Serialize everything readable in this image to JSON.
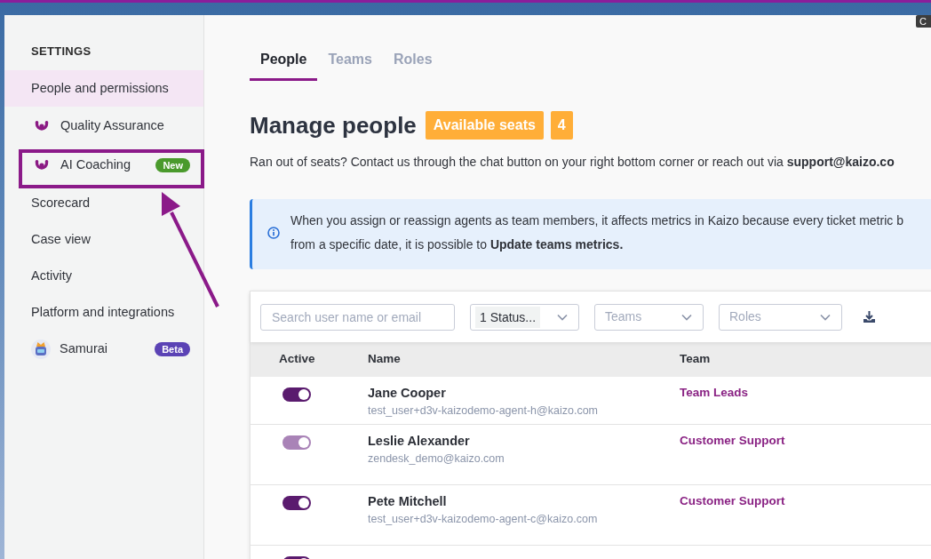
{
  "tooltip": {
    "text": "C"
  },
  "sidebar": {
    "heading": "SETTINGS",
    "items": [
      {
        "label": "People and permissions",
        "kind": "plain",
        "selected": true,
        "highlighted": false
      },
      {
        "label": "Quality Assurance",
        "kind": "logo",
        "selected": false,
        "highlighted": false
      },
      {
        "label": "AI Coaching",
        "kind": "logo",
        "selected": false,
        "highlighted": true,
        "badge": {
          "label": "New",
          "color": "#4a9a2c"
        }
      },
      {
        "label": "Scorecard",
        "kind": "plain",
        "selected": false,
        "highlighted": false
      },
      {
        "label": "Case view",
        "kind": "plain",
        "selected": false,
        "highlighted": false
      },
      {
        "label": "Activity",
        "kind": "plain",
        "selected": false,
        "highlighted": false
      },
      {
        "label": "Platform and integrations",
        "kind": "plain",
        "selected": false,
        "highlighted": false
      },
      {
        "label": "Samurai",
        "kind": "avatar",
        "selected": false,
        "highlighted": false,
        "badge": {
          "label": "Beta",
          "color": "#5b43b5"
        }
      }
    ]
  },
  "tabs": [
    {
      "label": "People",
      "selected": true
    },
    {
      "label": "Teams",
      "selected": false
    },
    {
      "label": "Roles",
      "selected": false
    }
  ],
  "heading": {
    "title": "Manage people",
    "seats_label": "Available seats",
    "seats_count": "4"
  },
  "notice": "Ran out of seats? Contact us through the chat button on your right bottom corner or reach out via **support@kaizo.co**",
  "info_banner": {
    "lines": [
      "When you assign or reassign agents as team members, it affects metrics in Kaizo because every ticket metric b",
      "from a specific date, it is possible to **Update teams metrics.**"
    ]
  },
  "filters": {
    "search": {
      "placeholder": "Search user name or email"
    },
    "status": {
      "value": "1 Status..."
    },
    "teams": {
      "placeholder": "Teams"
    },
    "roles": {
      "placeholder": "Roles"
    }
  },
  "table": {
    "columns": [
      "Active",
      "Name",
      "Team"
    ],
    "rows": [
      {
        "active": true,
        "disabled": false,
        "name": "Jane Cooper",
        "email": "test_user+d3v-kaizodemo-agent-h@kaizo.com",
        "team": "Team Leads"
      },
      {
        "active": true,
        "disabled": true,
        "name": "Leslie Alexander",
        "email": "zendesk_demo@kaizo.com",
        "team": "Customer Support"
      },
      {
        "active": true,
        "disabled": false,
        "name": "Pete Mitchell",
        "email": "test_user+d3v-kaizodemo-agent-c@kaizo.com",
        "team": "Customer Support"
      },
      {
        "active": true,
        "disabled": false
      }
    ]
  }
}
